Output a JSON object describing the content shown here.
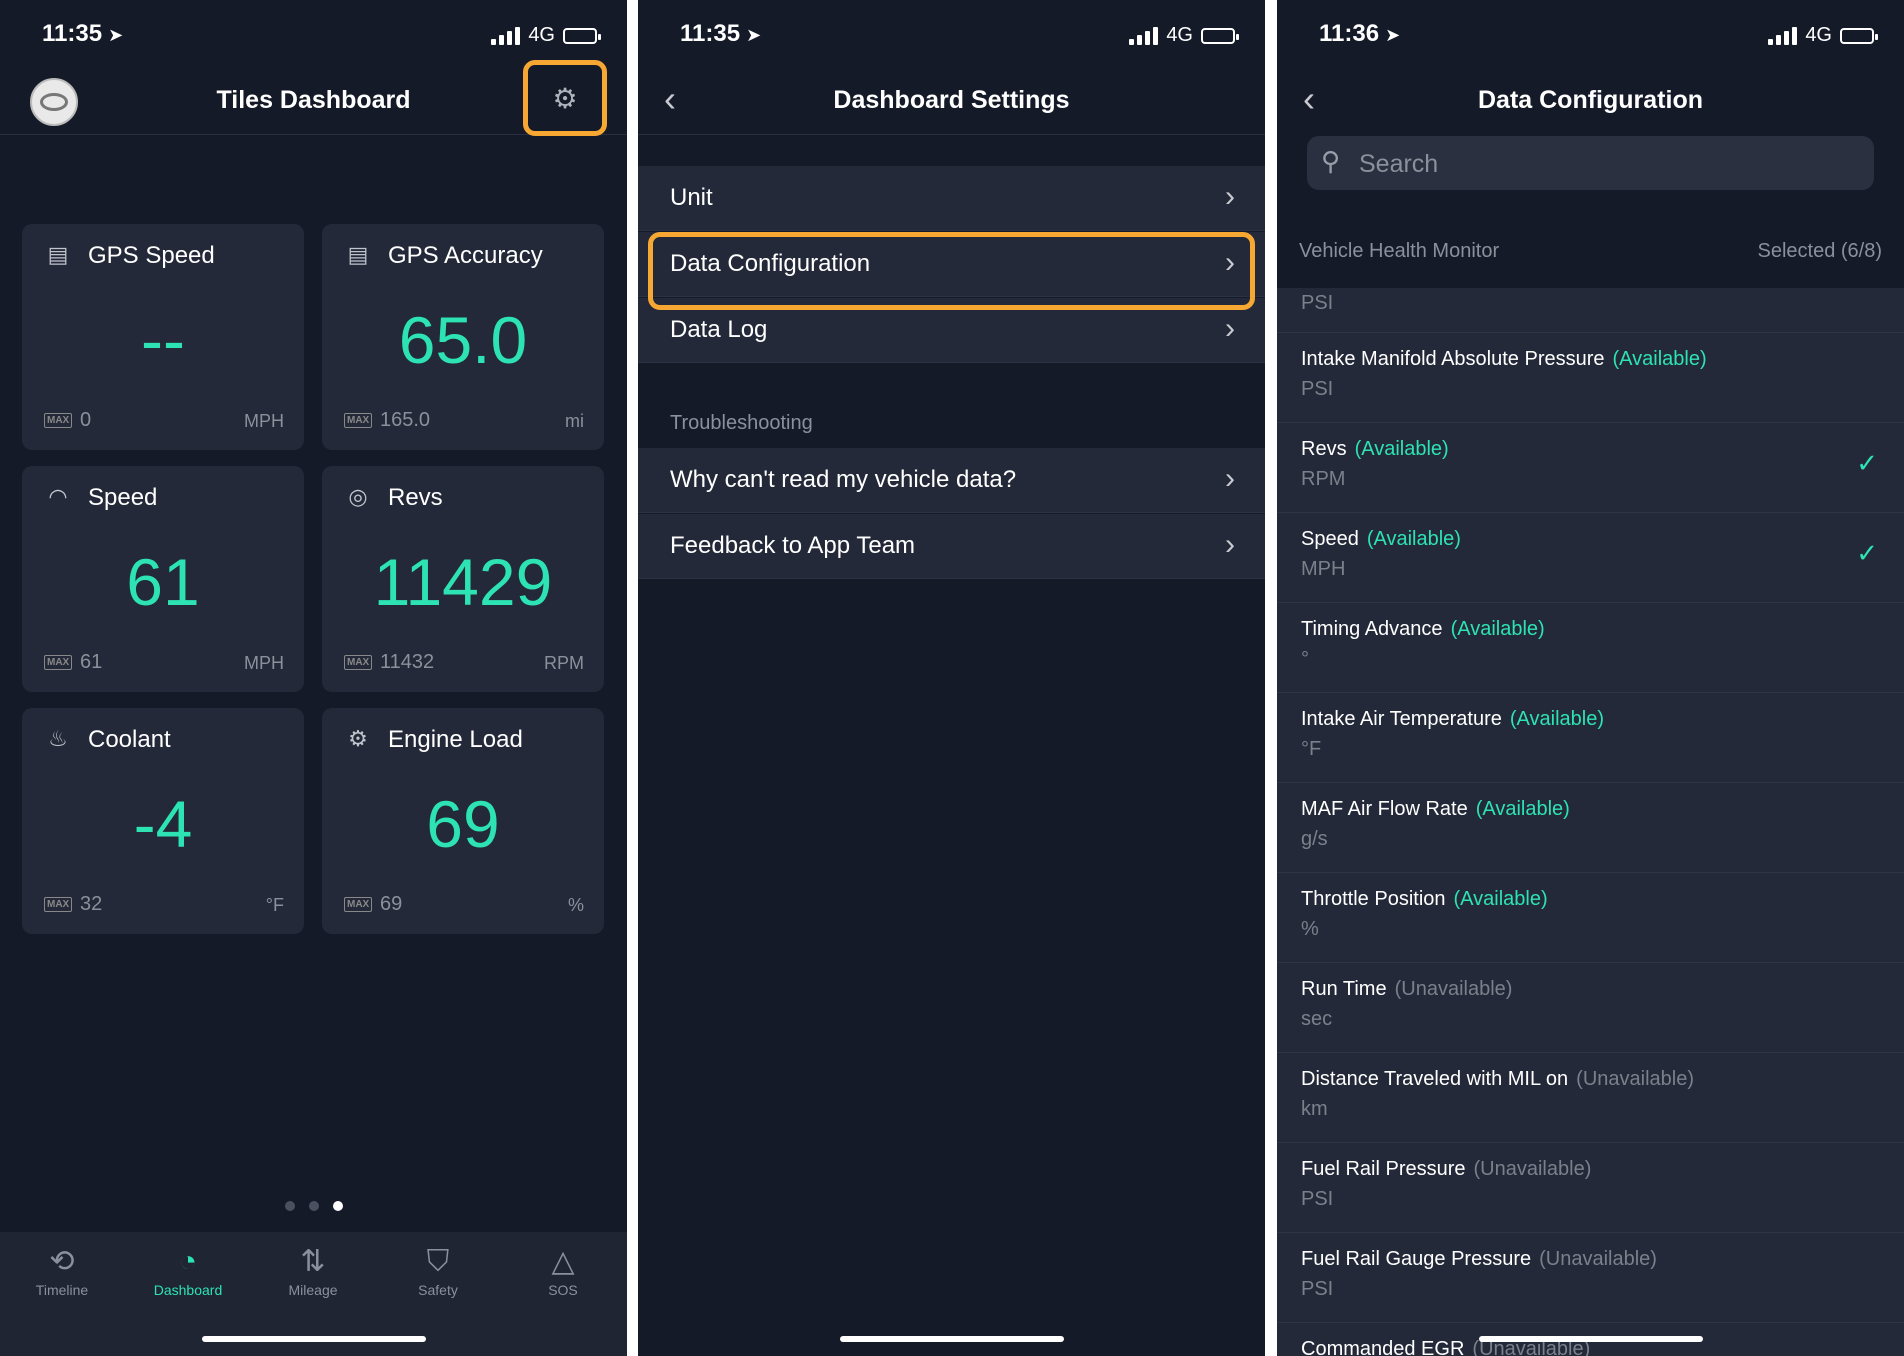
{
  "screen1": {
    "status": {
      "time": "11:35",
      "network": "4G"
    },
    "title": "Tiles Dashboard",
    "tiles": [
      {
        "label": "GPS Speed",
        "value": "--",
        "max": "0",
        "unit": "MPH",
        "icon": "data-icon"
      },
      {
        "label": "GPS Accuracy",
        "value": "65.0",
        "max": "165.0",
        "unit": "mi",
        "icon": "data-icon"
      },
      {
        "label": "Speed",
        "value": "61",
        "max": "61",
        "unit": "MPH",
        "icon": "speedometer-icon"
      },
      {
        "label": "Revs",
        "value": "11429",
        "max": "11432",
        "unit": "RPM",
        "icon": "gauge-icon"
      },
      {
        "label": "Coolant",
        "value": "-4",
        "max": "32",
        "unit": "°F",
        "icon": "thermometer-icon"
      },
      {
        "label": "Engine Load",
        "value": "69",
        "max": "69",
        "unit": "%",
        "icon": "engine-icon"
      }
    ],
    "max_badge": "MAX",
    "tabs": [
      "Timeline",
      "Dashboard",
      "Mileage",
      "Safety",
      "SOS"
    ],
    "active_tab": "Dashboard"
  },
  "screen2": {
    "status": {
      "time": "11:35",
      "network": "4G"
    },
    "title": "Dashboard Settings",
    "rows": [
      "Unit",
      "Data Configuration",
      "Data Log"
    ],
    "section": "Troubleshooting",
    "trouble_rows": [
      "Why can't read my vehicle data?",
      "Feedback to App Team"
    ]
  },
  "screen3": {
    "status": {
      "time": "11:36",
      "network": "4G"
    },
    "title": "Data Configuration",
    "search_placeholder": "Search",
    "section": "Vehicle Health Monitor",
    "selected": "Selected (6/8)",
    "top_unit": "PSI",
    "items": [
      {
        "name": "Intake Manifold Absolute Pressure",
        "status": "(Available)",
        "unit": "PSI",
        "checked": false
      },
      {
        "name": "Revs",
        "status": "(Available)",
        "unit": "RPM",
        "checked": true
      },
      {
        "name": "Speed",
        "status": "(Available)",
        "unit": "MPH",
        "checked": true
      },
      {
        "name": "Timing Advance",
        "status": "(Available)",
        "unit": "°",
        "checked": false
      },
      {
        "name": "Intake Air Temperature",
        "status": "(Available)",
        "unit": "°F",
        "checked": false
      },
      {
        "name": "MAF Air Flow Rate",
        "status": "(Available)",
        "unit": "g/s",
        "checked": false
      },
      {
        "name": "Throttle Position",
        "status": "(Available)",
        "unit": "%",
        "checked": false
      },
      {
        "name": "Run Time",
        "status": "(Unavailable)",
        "unit": "sec",
        "checked": false
      },
      {
        "name": "Distance Traveled with MIL on",
        "status": "(Unavailable)",
        "unit": "km",
        "checked": false
      },
      {
        "name": "Fuel Rail Pressure",
        "status": "(Unavailable)",
        "unit": "PSI",
        "checked": false
      },
      {
        "name": "Fuel Rail Gauge Pressure",
        "status": "(Unavailable)",
        "unit": "PSI",
        "checked": false
      },
      {
        "name": "Commanded EGR",
        "status": "(Unavailable)",
        "unit": "",
        "checked": false
      }
    ]
  },
  "colors": {
    "accent": "#2de3b3",
    "highlight": "#f7a833",
    "background": "#151a28",
    "card": "#232938"
  }
}
